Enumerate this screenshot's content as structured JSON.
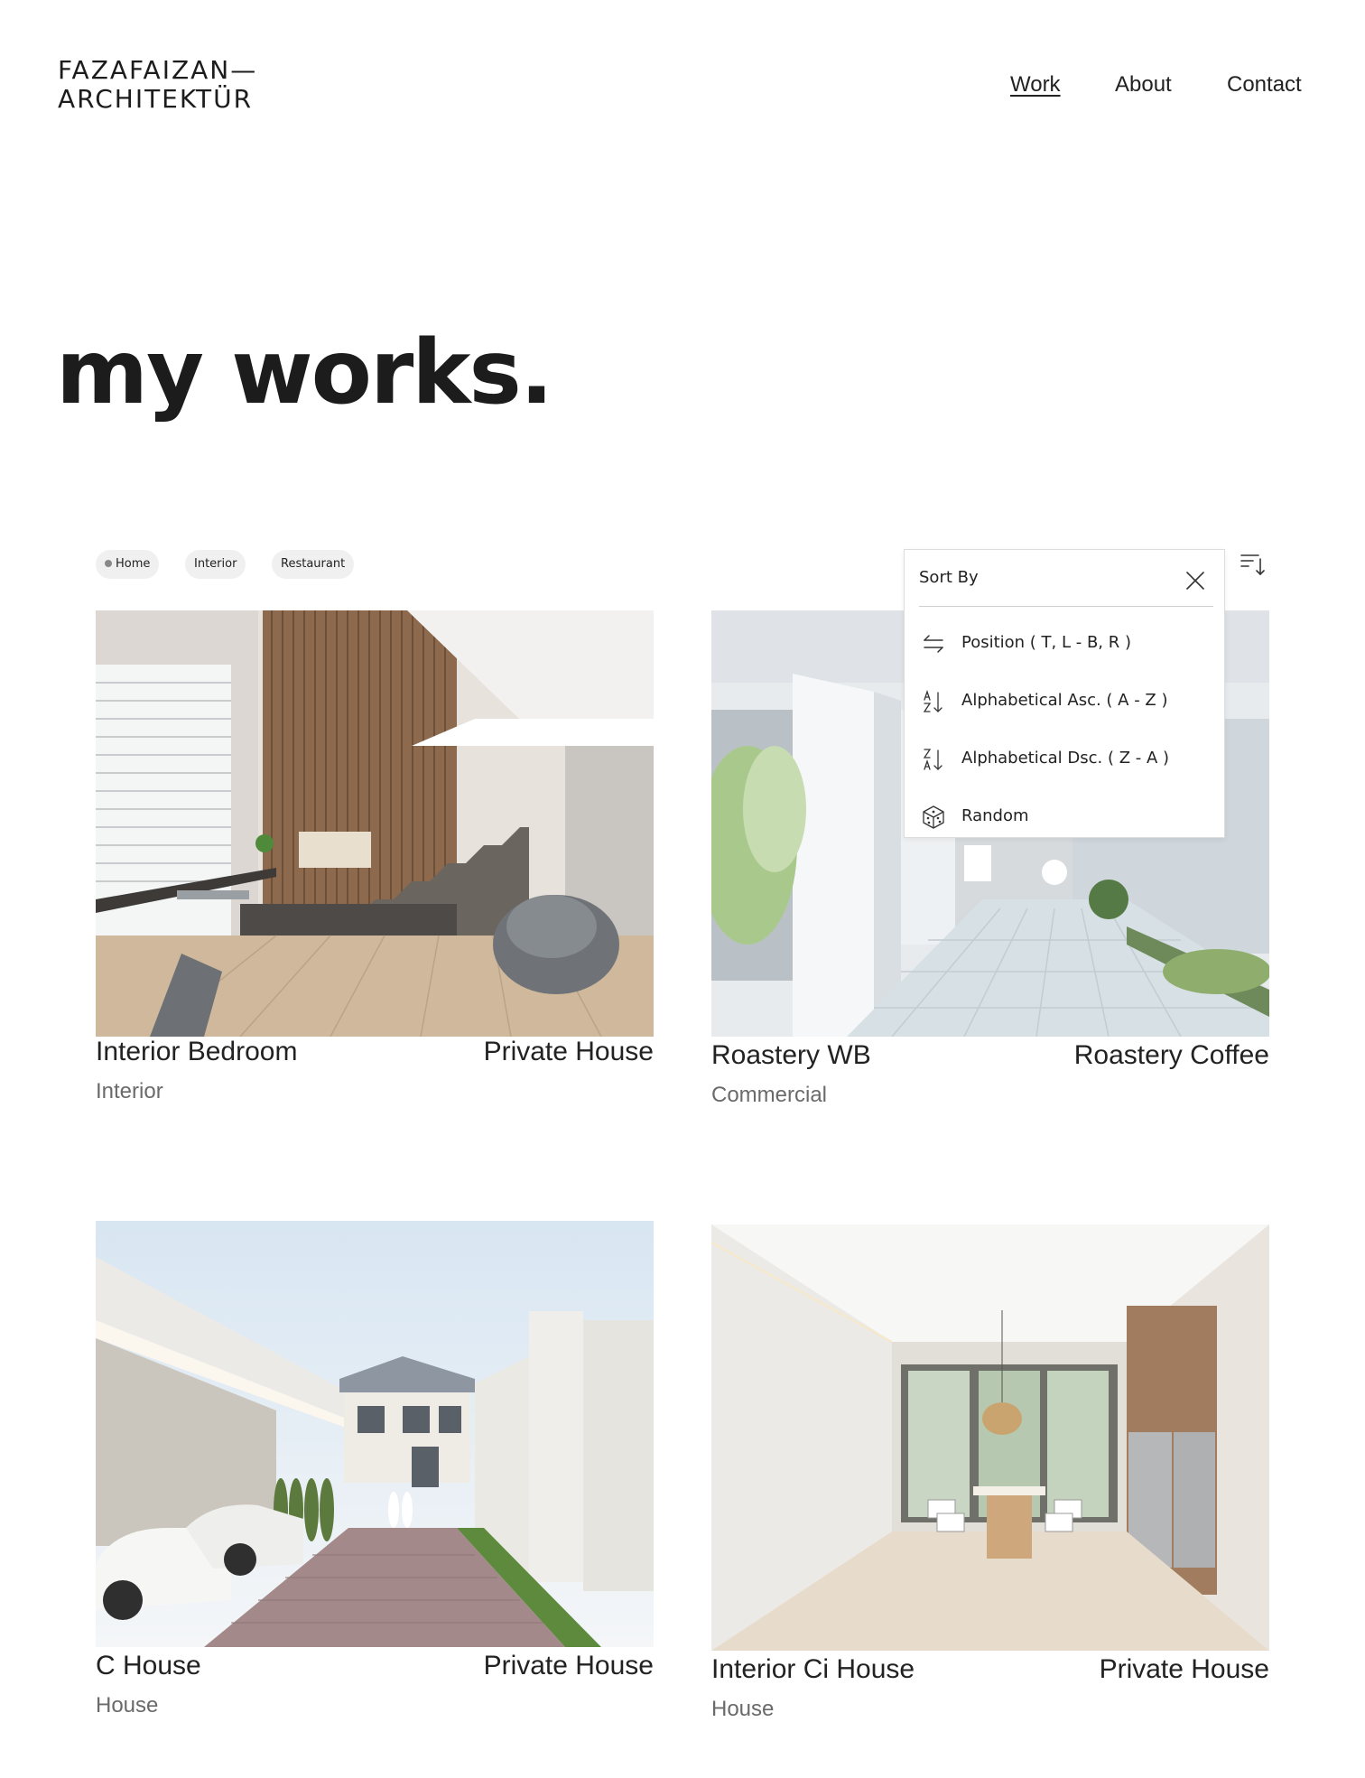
{
  "brand": {
    "line1": "FAZAFAIZAN—",
    "line2": "ARCHITEKTÜR"
  },
  "nav": [
    {
      "label": "Work",
      "active": true
    },
    {
      "label": "About",
      "active": false
    },
    {
      "label": "Contact",
      "active": false
    }
  ],
  "hero_title": "my works.",
  "filters": [
    {
      "label": "Home",
      "selected": true
    },
    {
      "label": "Interior",
      "selected": false
    },
    {
      "label": "Restaurant",
      "selected": false
    }
  ],
  "sort_menu": {
    "title": "Sort By",
    "options": [
      {
        "label": "Position ( T, L - B, R )",
        "icon": "swap-arrows-icon"
      },
      {
        "label": "Alphabetical Asc. ( A - Z )",
        "icon": "sort-az-icon"
      },
      {
        "label": "Alphabetical Dsc. ( Z - A )",
        "icon": "sort-za-icon"
      },
      {
        "label": "Random",
        "icon": "dice-icon"
      }
    ]
  },
  "projects": [
    {
      "title": "Interior Bedroom",
      "type": "Private House",
      "category": "Interior"
    },
    {
      "title": "Roastery WB",
      "type": "Roastery Coffee",
      "category": "Commercial"
    },
    {
      "title": "C House",
      "type": "Private House",
      "category": "House"
    },
    {
      "title": "Interior Ci House",
      "type": "Private House",
      "category": "House"
    }
  ],
  "colors": {
    "text": "#222222",
    "muted": "#6a6a6a",
    "chip_bg": "#f0f0f0",
    "border": "#dddddd"
  }
}
